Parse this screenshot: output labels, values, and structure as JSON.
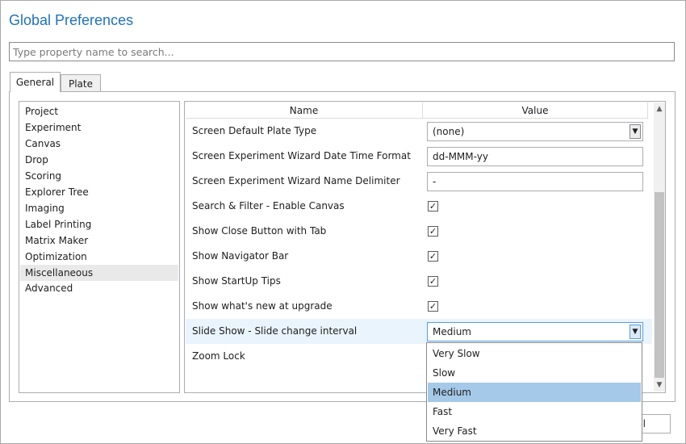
{
  "window": {
    "title": "Global Preferences"
  },
  "search": {
    "placeholder": "Type property name to search..."
  },
  "tabs": [
    {
      "label": "General",
      "active": true
    },
    {
      "label": "Plate",
      "active": false
    }
  ],
  "categories": [
    {
      "label": "Project"
    },
    {
      "label": "Experiment"
    },
    {
      "label": "Canvas"
    },
    {
      "label": "Drop"
    },
    {
      "label": "Scoring"
    },
    {
      "label": "Explorer Tree"
    },
    {
      "label": "Imaging"
    },
    {
      "label": "Label Printing"
    },
    {
      "label": "Matrix Maker"
    },
    {
      "label": "Optimization"
    },
    {
      "label": "Miscellaneous",
      "selected": true
    },
    {
      "label": "Advanced"
    }
  ],
  "grid": {
    "headers": {
      "name": "Name",
      "value": "Value"
    },
    "rows": [
      {
        "name": "Screen Default Plate Type",
        "type": "combo",
        "value": "(none)"
      },
      {
        "name": "Screen Experiment Wizard Date Time Format",
        "type": "text",
        "value": "dd-MMM-yy"
      },
      {
        "name": "Screen Experiment Wizard Name Delimiter",
        "type": "text",
        "value": "-"
      },
      {
        "name": "Search & Filter - Enable Canvas",
        "type": "checkbox",
        "checked": true,
        "mark": "✓"
      },
      {
        "name": "Show Close Button with Tab",
        "type": "checkbox",
        "checked": true,
        "mark": "✓"
      },
      {
        "name": "Show Navigator Bar",
        "type": "checkbox",
        "checked": true,
        "mark": "✓"
      },
      {
        "name": "Show StartUp Tips",
        "type": "checkbox",
        "checked": true,
        "mark": "✓"
      },
      {
        "name": "Show what's new at upgrade",
        "type": "checkbox",
        "checked": true,
        "mark": "✓"
      },
      {
        "name": "Slide Show - Slide change interval",
        "type": "combo",
        "value": "Medium",
        "highlighted": true,
        "open": true
      },
      {
        "name": "Zoom Lock",
        "type": "checkbox",
        "checked": false
      }
    ]
  },
  "dropdown": {
    "options": [
      "Very Slow",
      "Slow",
      "Medium",
      "Fast",
      "Very Fast"
    ],
    "selected": "Medium"
  },
  "buttons": {
    "partial_label": "l"
  },
  "icons": {
    "dropdown": "chevron-down-icon",
    "scroll_up": "scroll-up-icon",
    "scroll_down": "scroll-down-icon",
    "check": "checkmark-icon"
  },
  "colors": {
    "title": "#1e73be",
    "selection": "#a5c9e8",
    "row_highlight": "#eaf4fc"
  }
}
